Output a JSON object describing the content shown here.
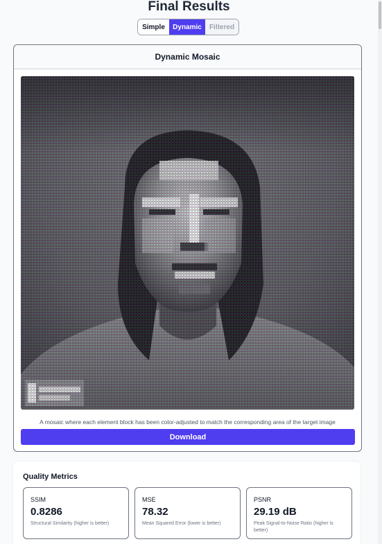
{
  "page": {
    "title": "Final Results"
  },
  "view_toggle": {
    "options": [
      "Simple",
      "Dynamic",
      "Filtered"
    ],
    "selected": "Dynamic"
  },
  "mosaic_card": {
    "header": "Dynamic Mosaic",
    "caption": "A mosaic where each element block has been color-adjusted to match the corresponding area of the target image",
    "download_label": "Download"
  },
  "metrics": {
    "title": "Quality Metrics",
    "items": [
      {
        "label": "SSIM",
        "value": "0.8286",
        "description": "Structural Similarity (higher is better)"
      },
      {
        "label": "MSE",
        "value": "78.32",
        "description": "Mean Squared Error (lower is better)"
      },
      {
        "label": "PSNR",
        "value": "29.19 dB",
        "description": "Peak Signal-to-Noise Ratio (higher is better)"
      }
    ]
  },
  "colors": {
    "accent": "#4f3df0"
  }
}
